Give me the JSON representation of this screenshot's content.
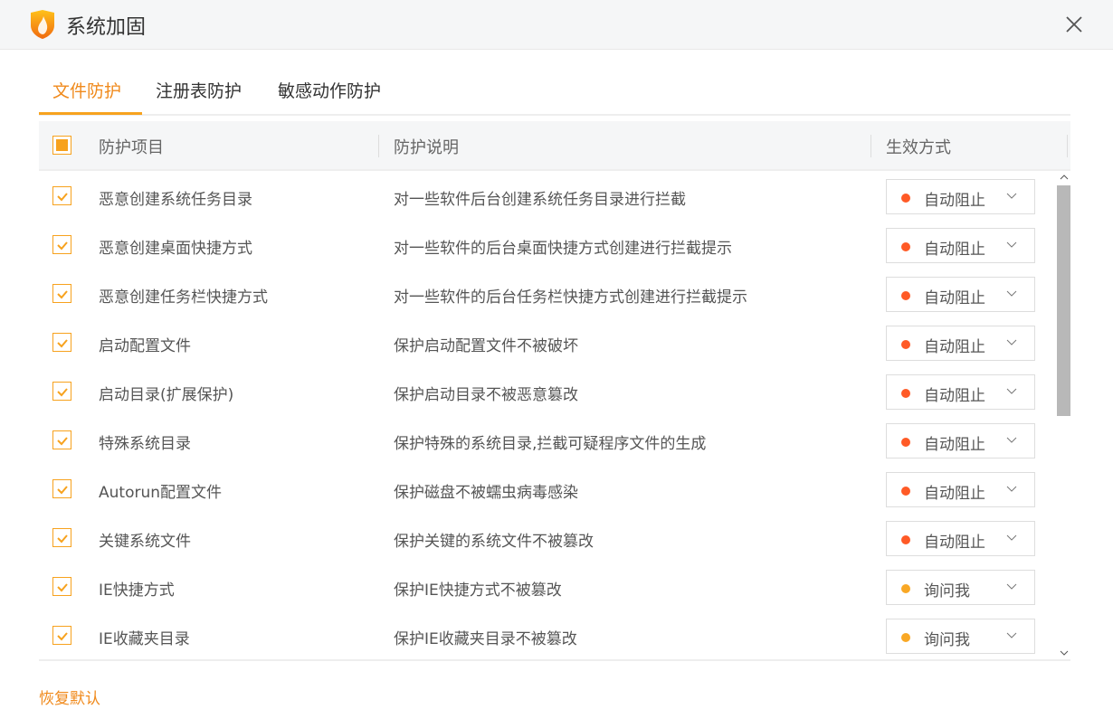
{
  "window": {
    "title": "系统加固"
  },
  "tabs": [
    {
      "label": "文件防护"
    },
    {
      "label": "注册表防护"
    },
    {
      "label": "敏感动作防护"
    }
  ],
  "table": {
    "headers": {
      "item": "防护项目",
      "desc": "防护说明",
      "mode": "生效方式"
    },
    "rows": [
      {
        "item": "恶意创建系统任务目录",
        "desc": "对一些软件后台创建系统任务目录进行拦截",
        "mode": "自动阻止",
        "color": "#ff5a26"
      },
      {
        "item": "恶意创建桌面快捷方式",
        "desc": "对一些软件的后台桌面快捷方式创建进行拦截提示",
        "mode": "自动阻止",
        "color": "#ff5a26"
      },
      {
        "item": "恶意创建任务栏快捷方式",
        "desc": "对一些软件的后台任务栏快捷方式创建进行拦截提示",
        "mode": "自动阻止",
        "color": "#ff5a26"
      },
      {
        "item": "启动配置文件",
        "desc": "保护启动配置文件不被破坏",
        "mode": "自动阻止",
        "color": "#ff5a26"
      },
      {
        "item": "启动目录(扩展保护)",
        "desc": "保护启动目录不被恶意篡改",
        "mode": "自动阻止",
        "color": "#ff5a26"
      },
      {
        "item": "特殊系统目录",
        "desc": "保护特殊的系统目录,拦截可疑程序文件的生成",
        "mode": "自动阻止",
        "color": "#ff5a26"
      },
      {
        "item": "Autorun配置文件",
        "desc": "保护磁盘不被蠕虫病毒感染",
        "mode": "自动阻止",
        "color": "#ff5a26"
      },
      {
        "item": "关键系统文件",
        "desc": "保护关键的系统文件不被篡改",
        "mode": "自动阻止",
        "color": "#ff5a26"
      },
      {
        "item": "IE快捷方式",
        "desc": "保护IE快捷方式不被篡改",
        "mode": "询问我",
        "color": "#f9a825"
      },
      {
        "item": "IE收藏夹目录",
        "desc": "保护IE收藏夹目录不被篡改",
        "mode": "询问我",
        "color": "#f9a825"
      }
    ]
  },
  "footer": {
    "restore_label": "恢复默认"
  }
}
